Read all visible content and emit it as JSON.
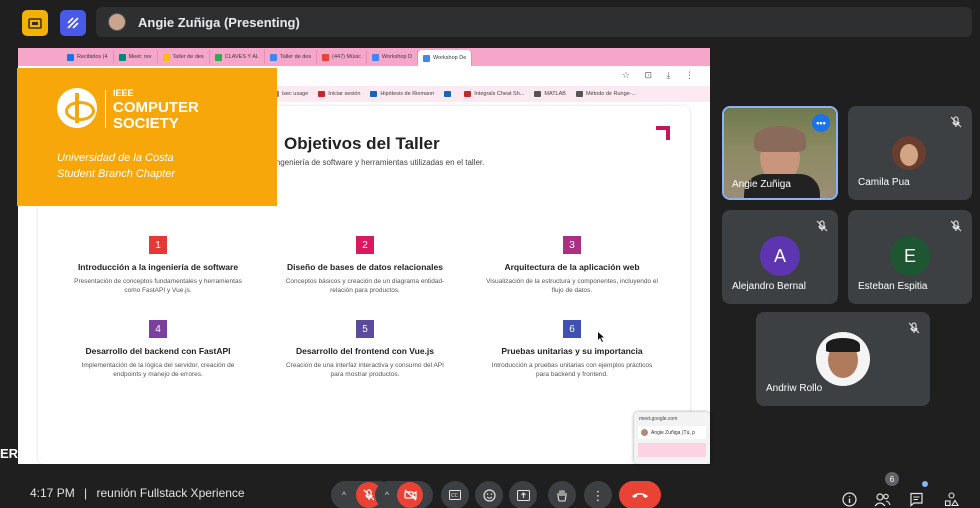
{
  "topbar": {
    "presenter": "Angie Zuñiga (Presenting)"
  },
  "browser": {
    "tabs": [
      {
        "label": "Recibidos (4",
        "color": "#1a73e8"
      },
      {
        "label": "Meet: rev",
        "color": "#00897b"
      },
      {
        "label": "Taller de des",
        "color": "#fbbc04"
      },
      {
        "label": "CLAVES Y AL",
        "color": "#34a853"
      },
      {
        "label": "Taller de des",
        "color": "#4285f4"
      },
      {
        "label": "(447) Músic",
        "color": "#ea4335"
      },
      {
        "label": "Workshop D",
        "color": "#4285f4"
      },
      {
        "label": "Workshop De",
        "color": "#4285f4"
      }
    ],
    "bookmarks": [
      {
        "label": "isec usage",
        "color": "#888"
      },
      {
        "label": "Iniciar sesión",
        "color": "#c62828"
      },
      {
        "label": "Hipótesis de Riemann",
        "color": "#1565c0"
      },
      {
        "label": "",
        "color": "#1565c0"
      },
      {
        "label": "Integrals Cheat Sh...",
        "color": "#c62828"
      },
      {
        "label": "MATLAB",
        "color": "#555"
      },
      {
        "label": "Método de Runge-...",
        "color": "#555"
      }
    ]
  },
  "slide": {
    "title": "Objetivos del Taller",
    "subtitle": "ingeniería de software y herramientas utilizadas en el taller.",
    "objectives": [
      {
        "num": "1",
        "color": "#e53935",
        "title": "Introducción a la ingeniería de software",
        "desc": "Presentación de conceptos fundamentales y herramientas como FastAPI y Vue.js."
      },
      {
        "num": "2",
        "color": "#d81b60",
        "title": "Diseño de bases de datos relacionales",
        "desc": "Conceptos básicos y creación de un diagrama entidad-relación para productos."
      },
      {
        "num": "3",
        "color": "#ab2f82",
        "title": "Arquitectura de la aplicación web",
        "desc": "Visualización de la estructura y componentes, incluyendo el flujo de datos."
      },
      {
        "num": "4",
        "color": "#7b3fa0",
        "title": "Desarrollo del backend con FastAPI",
        "desc": "Implementación de la lógica del servidor, creación de endpoints y manejo de errores."
      },
      {
        "num": "5",
        "color": "#5c4a9e",
        "title": "Desarrollo del frontend con Vue.js",
        "desc": "Creación de una interfaz interactiva y consumo del API para mostrar productos."
      },
      {
        "num": "6",
        "color": "#3f51b5",
        "title": "Pruebas unitarias y su importancia",
        "desc": "Introducción a pruebas unitarias con ejemplos prácticos para backend y frontend."
      }
    ]
  },
  "ieee": {
    "line1": "IEEE",
    "line2": "COMPUTER",
    "line3": "SOCIETY",
    "sub1": "Universidad de la Costa",
    "sub2": "Student Branch Chapter"
  },
  "popup": {
    "url": "meet.google.com",
    "row": "Angie Zuñiga (Tú, p"
  },
  "participants": [
    {
      "name": "Angie Zuñiga"
    },
    {
      "name": "Camila Pua"
    },
    {
      "name": "Alejandro Bernal",
      "initial": "A",
      "color": "#5e35b1"
    },
    {
      "name": "Esteban Espitia",
      "initial": "E",
      "color": "#1e5631"
    },
    {
      "name": "Andriw Rollo"
    }
  ],
  "meeting": {
    "time": "4:17 PM",
    "separator": "|",
    "name": "reunión Fullstack Xperience"
  },
  "people_count": "6",
  "left_edge": {
    "er": "ER"
  },
  "colors": {
    "hangup": "#ea4335",
    "accent": "#f7a70a",
    "brand": "#1a73e8"
  }
}
